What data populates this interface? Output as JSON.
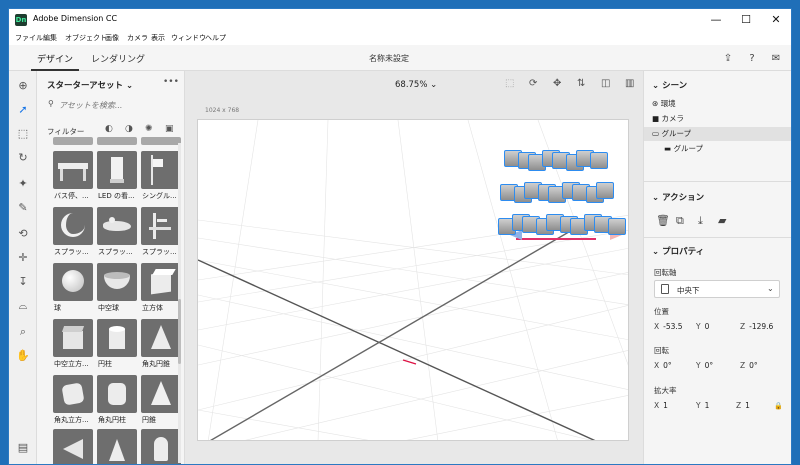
{
  "window": {
    "title": "Adobe Dimension CC",
    "app_icon_text": "Dn",
    "controls": {
      "minimize": "—",
      "maximize": "☐",
      "close": "✕"
    }
  },
  "menu": [
    "ファイル",
    "編集",
    "オブジェクト",
    "画像",
    "カメラ",
    "表示",
    "ウィンドウ",
    "ヘルプ"
  ],
  "tabs": {
    "design": "デザイン",
    "render": "レンダリング"
  },
  "document_title": "名称未設定",
  "assets": {
    "title": "スターターアセット",
    "more": "•••",
    "search_placeholder": "アセットを検索...",
    "filter_label": "フィルター",
    "items": [
      {
        "label": "バス停、..."
      },
      {
        "label": "LED の看..."
      },
      {
        "label": "シングル..."
      },
      {
        "label": "スプラッ..."
      },
      {
        "label": "スプラッ..."
      },
      {
        "label": "スプラッ..."
      },
      {
        "label": "球"
      },
      {
        "label": "中空球"
      },
      {
        "label": "立方体"
      },
      {
        "label": "中空立方..."
      },
      {
        "label": "円柱"
      },
      {
        "label": "角丸円錐"
      },
      {
        "label": "角丸立方..."
      },
      {
        "label": "角丸円柱"
      },
      {
        "label": "円錐"
      },
      {
        "label": ""
      },
      {
        "label": ""
      },
      {
        "label": ""
      }
    ]
  },
  "viewport": {
    "zoom": "68.75%",
    "canvas_size": "1024 x 768"
  },
  "scene": {
    "title": "シーン",
    "items": [
      {
        "label": "環境",
        "icon": "environment-icon"
      },
      {
        "label": "カメラ",
        "icon": "camera-icon"
      },
      {
        "label": "グループ",
        "icon": "folder-icon",
        "selected": true
      },
      {
        "label": "グループ",
        "icon": "folder-icon",
        "child": true
      }
    ]
  },
  "actions": {
    "title": "アクション"
  },
  "properties": {
    "title": "プロパティ",
    "pivot_label": "回転軸",
    "pivot_value": "中央下",
    "position_label": "位置",
    "position": {
      "x": "-53.5",
      "y": "0",
      "z": "-129.6"
    },
    "rotation_label": "回転",
    "rotation": {
      "x": "0°",
      "y": "0°",
      "z": "0°"
    },
    "scale_label": "拡大率",
    "scale": {
      "x": "1",
      "y": "1",
      "z": "1"
    }
  },
  "colors": {
    "accent": "#1473e6",
    "selection_outline": "#2d8cf0",
    "cube_gray": "#a9a9a9"
  }
}
